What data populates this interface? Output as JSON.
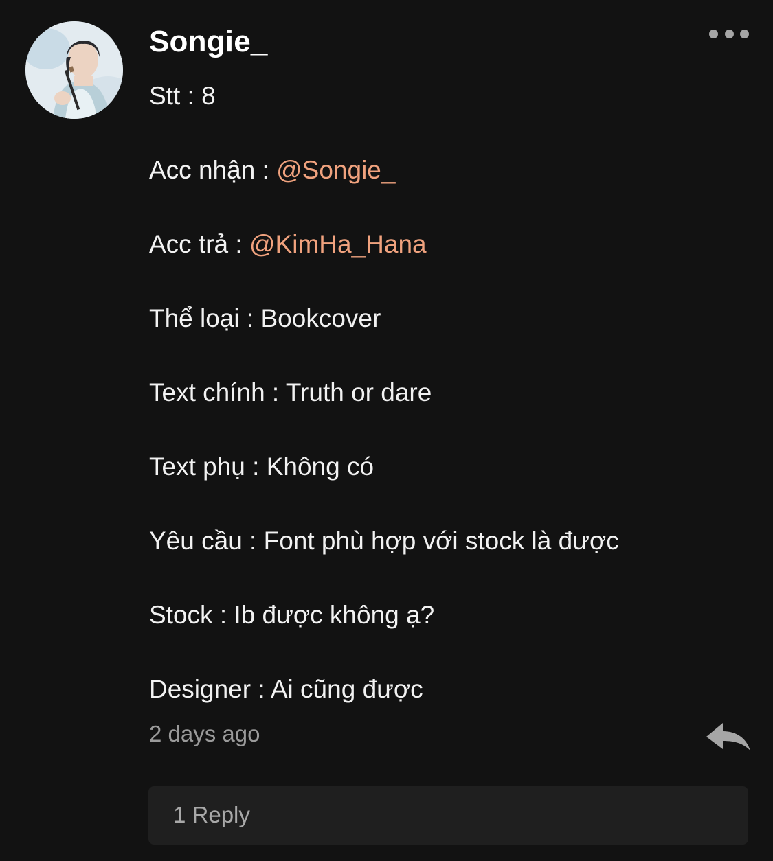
{
  "comment": {
    "username": "Songie_",
    "avatar_icon": "user-avatar-photo",
    "menu_icon": "more-options-icon",
    "lines": [
      {
        "label": "Stt : ",
        "value": "8",
        "mention": false
      },
      {
        "label": "Acc nhận : ",
        "value": "@Songie_",
        "mention": true
      },
      {
        "label": "Acc trả : ",
        "value": "@KimHa_Hana",
        "mention": true
      },
      {
        "label": "Thể loại : ",
        "value": "Bookcover",
        "mention": false
      },
      {
        "label": "Text chính : ",
        "value": "Truth or dare",
        "mention": false
      },
      {
        "label": "Text phụ : ",
        "value": "Không có",
        "mention": false
      },
      {
        "label": "Yêu cầu : ",
        "value": "Font phù hợp với stock là được",
        "mention": false
      },
      {
        "label": "Stock : ",
        "value": "Ib được không ạ?",
        "mention": false
      },
      {
        "label": "Designer : ",
        "value": "Ai cũng được",
        "mention": false
      }
    ],
    "timestamp": "2 days ago",
    "reply_icon": "reply-arrow-icon",
    "replies_label": "1 Reply"
  },
  "colors": {
    "background": "#121212",
    "mention": "#f0a27e",
    "muted_text": "#9a9a9a",
    "reply_box": "#1f1f1f"
  }
}
